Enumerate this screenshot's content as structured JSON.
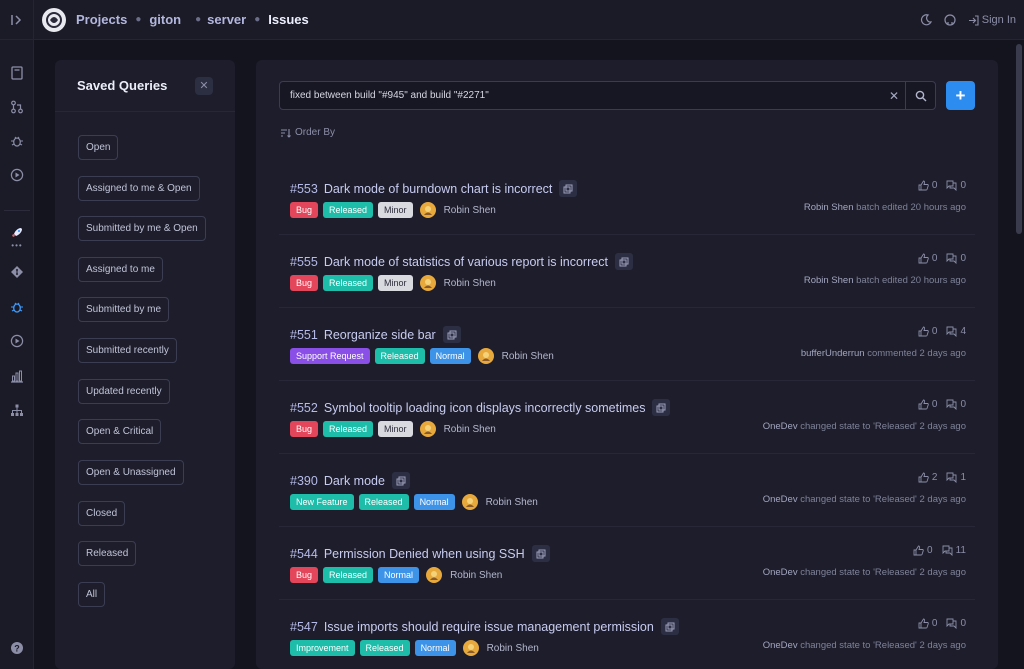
{
  "breadcrumbs": [
    "Projects",
    "giton",
    "server",
    "Issues"
  ],
  "topbar": {
    "signin_label": "Sign In"
  },
  "saved_queries": {
    "title": "Saved Queries",
    "items": [
      "Open",
      "Assigned to me & Open",
      "Submitted by me & Open",
      "Assigned to me",
      "Submitted by me",
      "Submitted recently",
      "Updated recently",
      "Open & Critical",
      "Open & Unassigned",
      "Closed",
      "Released",
      "All"
    ]
  },
  "search": {
    "query": "fixed between build \"#945\" and build \"#2271\""
  },
  "order_by_label": "Order By",
  "colors": {
    "bug": "#e3455a",
    "released": "#1ebda9",
    "minor": "#d9d9e0",
    "normal": "#3d93e8",
    "support_request": "#8a4fe6",
    "new_feature": "#1ebda9",
    "improvement": "#1ebda9",
    "accent": "#2d8cf0"
  },
  "issues": [
    {
      "number": "#553",
      "title": "Dark mode of burndown chart is incorrect",
      "labels": [
        "Bug",
        "Released",
        "Minor"
      ],
      "assignee": "Robin Shen",
      "votes": "0",
      "comments": "0",
      "actor": "Robin Shen",
      "activity": "batch edited 20 hours ago"
    },
    {
      "number": "#555",
      "title": "Dark mode of statistics of various report is incorrect",
      "labels": [
        "Bug",
        "Released",
        "Minor"
      ],
      "assignee": "Robin Shen",
      "votes": "0",
      "comments": "0",
      "actor": "Robin Shen",
      "activity": "batch edited 20 hours ago"
    },
    {
      "number": "#551",
      "title": "Reorganize side bar",
      "labels": [
        "Support Request",
        "Released",
        "Normal"
      ],
      "assignee": "Robin Shen",
      "votes": "0",
      "comments": "4",
      "actor": "bufferUnderrun",
      "activity": "commented 2 days ago"
    },
    {
      "number": "#552",
      "title": "Symbol tooltip loading icon displays incorrectly sometimes",
      "labels": [
        "Bug",
        "Released",
        "Minor"
      ],
      "assignee": "Robin Shen",
      "votes": "0",
      "comments": "0",
      "actor": "OneDev",
      "activity": "changed state to 'Released' 2 days ago"
    },
    {
      "number": "#390",
      "title": "Dark mode",
      "labels": [
        "New Feature",
        "Released",
        "Normal"
      ],
      "assignee": "Robin Shen",
      "votes": "2",
      "comments": "1",
      "actor": "OneDev",
      "activity": "changed state to 'Released' 2 days ago"
    },
    {
      "number": "#544",
      "title": "Permission Denied when using SSH",
      "labels": [
        "Bug",
        "Released",
        "Normal"
      ],
      "assignee": "Robin Shen",
      "votes": "0",
      "comments": "11",
      "actor": "OneDev",
      "activity": "changed state to 'Released' 2 days ago"
    },
    {
      "number": "#547",
      "title": "Issue imports should require issue management permission",
      "labels": [
        "Improvement",
        "Released",
        "Normal"
      ],
      "assignee": "Robin Shen",
      "votes": "0",
      "comments": "0",
      "actor": "OneDev",
      "activity": "changed state to 'Released' 2 days ago"
    }
  ]
}
